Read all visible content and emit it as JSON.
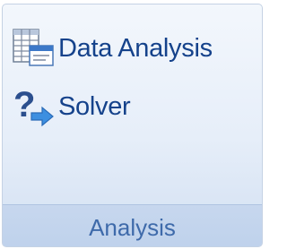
{
  "group": {
    "name": "Analysis",
    "commands": [
      {
        "label": "Data Analysis",
        "icon": "data-analysis-icon"
      },
      {
        "label": "Solver",
        "icon": "solver-icon"
      }
    ]
  },
  "colors": {
    "label_text": "#15428b",
    "group_label_text": "#3e6aaa",
    "footer_bg": "#c7d7ee",
    "group_border": "#c5d2e4"
  }
}
